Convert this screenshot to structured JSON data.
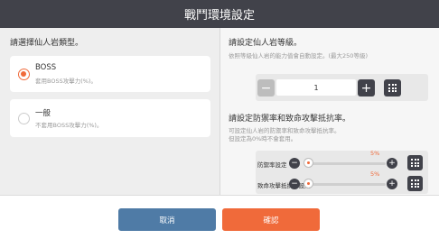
{
  "header": {
    "title": "戰鬥環境設定"
  },
  "left": {
    "title": "請選擇仙人岩類型。",
    "options": [
      {
        "title": "BOSS",
        "desc": "套用BOSS攻擊力(%)。",
        "selected": true
      },
      {
        "title": "一般",
        "desc": "不套用BOSS攻擊力(%)。",
        "selected": false
      }
    ]
  },
  "level": {
    "title": "請設定仙人岩等級。",
    "hint": "依照等級仙人岩的能力值會自動設定。(最大250等級)",
    "value": "1",
    "minus_symbol": "−",
    "plus_symbol": "+"
  },
  "defense": {
    "title": "請設定防禦率和致命攻擊抵抗率。",
    "hint_line1": "可設定仙人岩的防禦率和致命攻擊抵抗率。",
    "hint_line2": "但設定為0%時不會套用。",
    "rows": [
      {
        "label": "防禦率設定",
        "value_text": "5%",
        "value": 5
      },
      {
        "label": "致命攻擊抵抗率設定",
        "value_text": "5%",
        "value": 5
      }
    ]
  },
  "buttons": {
    "cancel": "取消",
    "confirm": "確認"
  },
  "colors": {
    "accent": "#f06a3a",
    "header_bg": "#41424a",
    "cancel_bg": "#4f7ba6"
  }
}
